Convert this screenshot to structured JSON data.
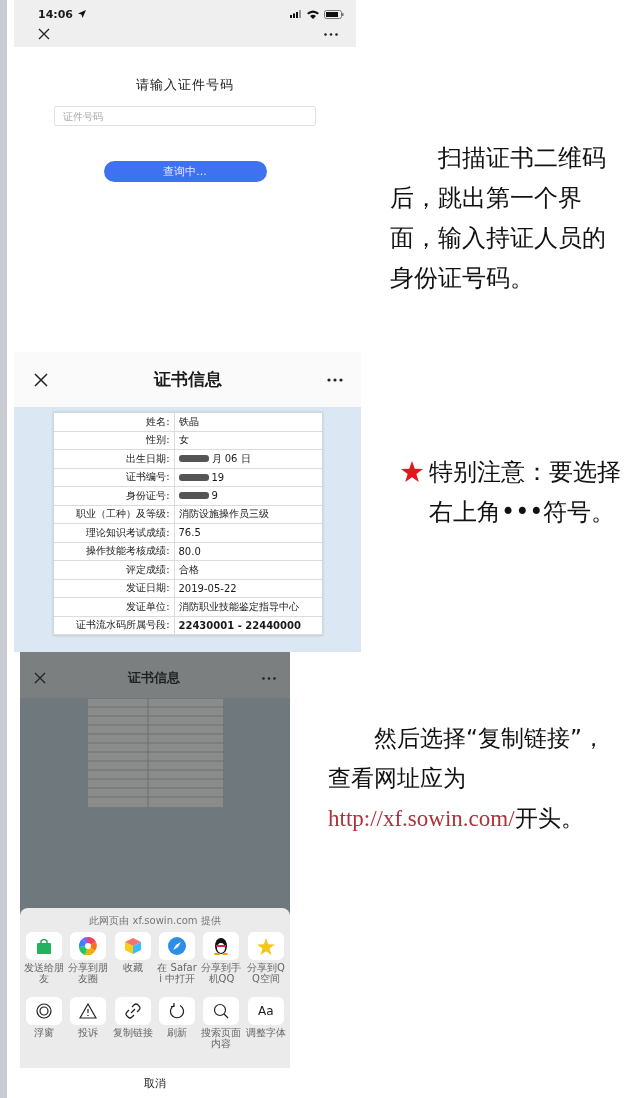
{
  "query_screen": {
    "status_time": "14:06",
    "title": "请输入证件号码",
    "input": {
      "placeholder": "证件号码"
    },
    "button": "查询中..."
  },
  "note_1": {
    "text": "扫描证书二维码后，跳出第一个界面，输入持证人员的身份证号码。"
  },
  "certificate_screen": {
    "title": "证书信息",
    "rows": [
      {
        "label": "姓名:",
        "value": "铁晶",
        "redacted": false
      },
      {
        "label": "性别:",
        "value": "女",
        "redacted": false
      },
      {
        "label": "出生日期:",
        "value": "月 06 日",
        "redacted": true
      },
      {
        "label": "证书编号:",
        "value": "19",
        "redacted": true
      },
      {
        "label": "身份证号:",
        "value": "9",
        "redacted": true
      },
      {
        "label": "职业（工种）及等级:",
        "value": "消防设施操作员三级",
        "redacted": false
      },
      {
        "label": "理论知识考试成绩:",
        "value": "76.5",
        "redacted": false
      },
      {
        "label": "操作技能考核成绩:",
        "value": "80.0",
        "redacted": false
      },
      {
        "label": "评定成绩:",
        "value": "合格",
        "redacted": false
      },
      {
        "label": "发证日期:",
        "value": "2019-05-22",
        "redacted": false
      },
      {
        "label": "发证单位:",
        "value": "消防职业技能鉴定指导中心",
        "redacted": false
      },
      {
        "label": "证书流水码所属号段:",
        "value": "22430001 - 22440000",
        "redacted": false,
        "bold": true
      }
    ]
  },
  "note_2": {
    "text": "特别注意：要选择右上角•••符号。"
  },
  "share_screen": {
    "title": "证书信息",
    "source": "此网页由 xf.sowin.com 提供",
    "actions": [
      {
        "kind": "bag",
        "label": "发送给朋友"
      },
      {
        "kind": "aperture",
        "label": "分享到朋友圈"
      },
      {
        "kind": "cube",
        "label": "收藏"
      },
      {
        "kind": "compass",
        "label": "在 Safari 中打开"
      },
      {
        "kind": "penguin",
        "label": "分享到手机QQ"
      },
      {
        "kind": "star",
        "label": "分享到QQ空间"
      }
    ],
    "tools": [
      {
        "kind": "rings",
        "label": "浮窗"
      },
      {
        "kind": "warning",
        "label": "投诉"
      },
      {
        "kind": "link",
        "label": "复制链接"
      },
      {
        "kind": "refresh",
        "label": "刷新"
      },
      {
        "kind": "search",
        "label": "搜索页面内容"
      },
      {
        "kind": "font",
        "glyph": "Aa",
        "label": "调整字体"
      }
    ],
    "cancel": "取消"
  },
  "note_3": {
    "before": "然后选择“复制链接”，查看网址应为",
    "link": "http://xf.sowin.com/",
    "after": "开头。"
  }
}
